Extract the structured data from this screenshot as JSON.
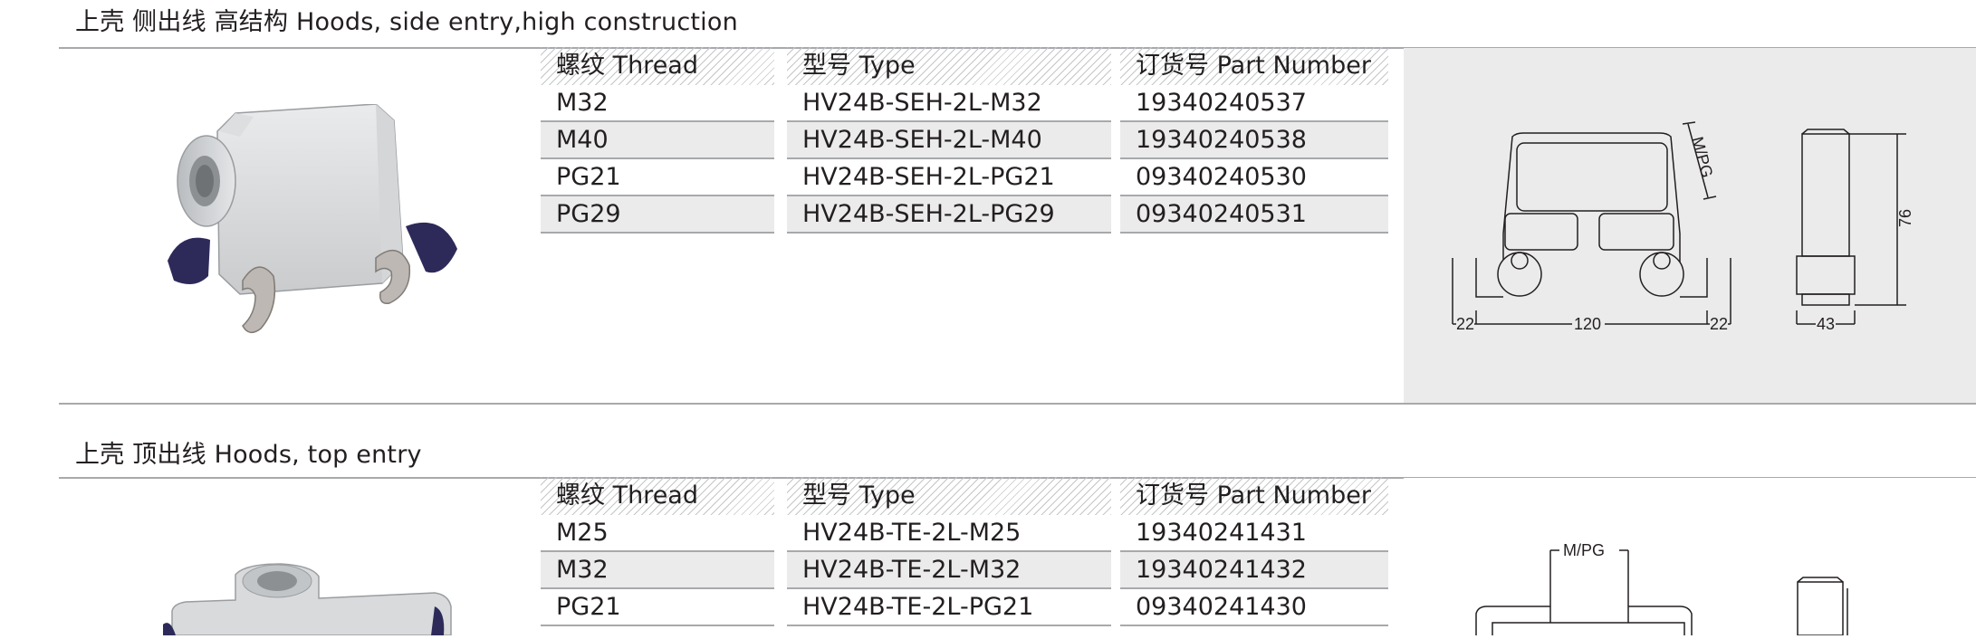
{
  "section1": {
    "title": "上壳 侧出线 高结构  Hoods, side entry,high construction",
    "headers": [
      "螺纹 Thread",
      "型号 Type",
      "订货号 Part Number"
    ],
    "rows": [
      [
        "M32",
        "HV24B-SEH-2L-M32",
        "19340240537"
      ],
      [
        "M40",
        "HV24B-SEH-2L-M40",
        "19340240538"
      ],
      [
        "PG21",
        "HV24B-SEH-2L-PG21",
        "09340240530"
      ],
      [
        "PG29",
        "HV24B-SEH-2L-PG29",
        "09340240531"
      ]
    ],
    "dims": {
      "left": "22",
      "center": "120",
      "right": "22",
      "side": "43",
      "height": "76",
      "thread": "M/PG"
    }
  },
  "section2": {
    "title": "上壳 顶出线  Hoods, top entry",
    "headers": [
      "螺纹 Thread",
      "型号 Type",
      "订货号 Part Number"
    ],
    "rows": [
      [
        "M25",
        "HV24B-TE-2L-M25",
        "19340241431"
      ],
      [
        "M32",
        "HV24B-TE-2L-M32",
        "19340241432"
      ],
      [
        "PG21",
        "HV24B-TE-2L-PG21",
        "09340241430"
      ]
    ],
    "dims": {
      "thread": "M/PG"
    }
  },
  "colors": {
    "rule": "#a7a9ac",
    "panel": "#ebebec",
    "text": "#231f20",
    "handle": "#2d2a5a"
  }
}
